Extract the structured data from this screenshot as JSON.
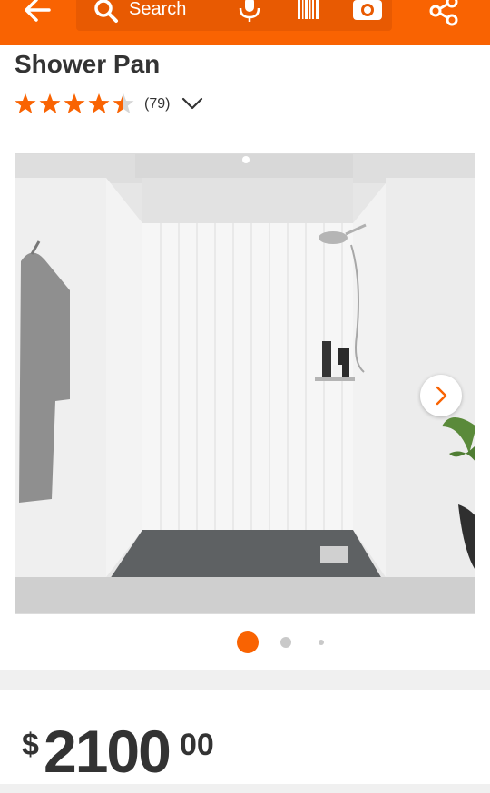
{
  "header": {
    "search_placeholder": "Search",
    "icons": [
      "back-arrow-icon",
      "search-icon",
      "microphone-icon",
      "barcode-scanner-icon",
      "camera-icon",
      "share-icon"
    ],
    "accent_color": "#f96302"
  },
  "product": {
    "title": "Shower Pan",
    "rating": 4.5,
    "review_count": "(79)"
  },
  "gallery": {
    "current_index": 1,
    "dots_visible": 3
  },
  "price": {
    "symbol": "$",
    "dollars": "2100",
    "cents": "00"
  }
}
